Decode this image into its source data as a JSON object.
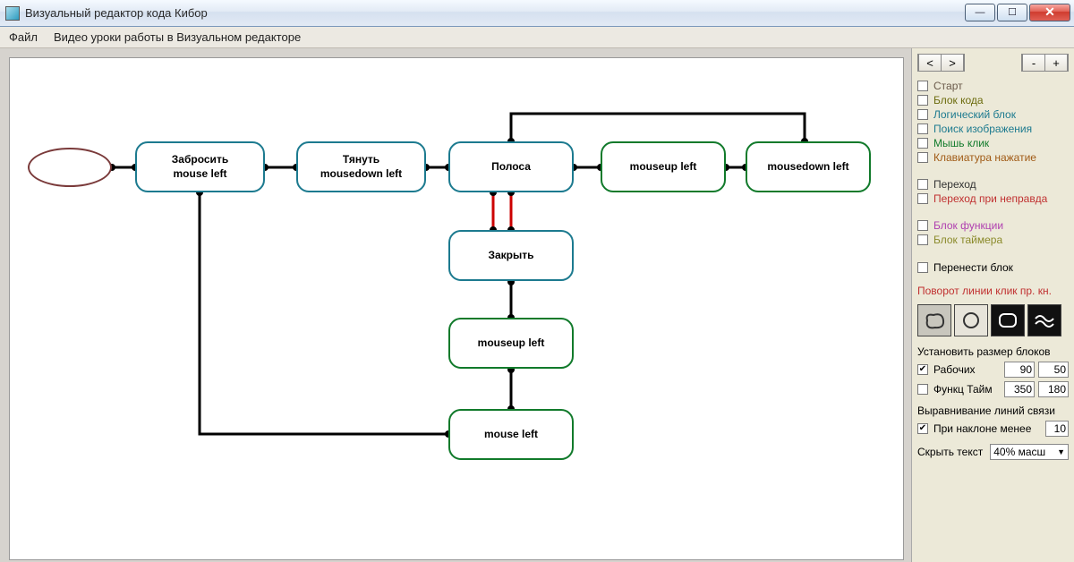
{
  "window": {
    "title": "Визуальный редактор кода Кибор"
  },
  "menu": {
    "file": "Файл",
    "video": "Видео уроки работы в Визуальном редакторе"
  },
  "nodes": {
    "n1": "Забросить\nmouse left",
    "n2": "Тянуть\nmousedown left",
    "n3": "Полоса",
    "n4": "mouseup left",
    "n5": "mousedown left",
    "n6": "Закрыть",
    "n7": "mouseup left",
    "n8": "mouse left"
  },
  "side": {
    "nav_prev": "<",
    "nav_next": ">",
    "zoom_out": "-",
    "zoom_in": "+",
    "tools": [
      {
        "label": "Старт",
        "color": "#6a5a4a"
      },
      {
        "label": "Блок кода",
        "color": "#6b6b0c"
      },
      {
        "label": "Логический блок",
        "color": "#1c7a8f"
      },
      {
        "label": "Поиск изображения",
        "color": "#1c7a8f"
      },
      {
        "label": "Мышь клик",
        "color": "#117a2b"
      },
      {
        "label": "Клавиатура нажатие",
        "color": "#a05a15"
      }
    ],
    "transitions": [
      {
        "label": "Переход",
        "color": "#333"
      },
      {
        "label": "Переход при неправда",
        "color": "#c03030"
      }
    ],
    "funcs": [
      {
        "label": "Блок функции",
        "color": "#b040b0"
      },
      {
        "label": "Блок таймера",
        "color": "#8a8a2a"
      }
    ],
    "move_block": {
      "label": "Перенести блок",
      "color": "#333"
    },
    "rotate_hint": "Поворот линии клик пр. кн.",
    "size_label": "Установить размер блоков",
    "working": "Рабочих",
    "func_time": "Функц Тайм",
    "w1": "90",
    "h1": "50",
    "w2": "350",
    "h2": "180",
    "align_label": "Выравнивание линий связи",
    "tilt": "При наклоне менее",
    "tilt_val": "10",
    "hide_text": "Скрыть текст",
    "scale": "40% масш"
  }
}
